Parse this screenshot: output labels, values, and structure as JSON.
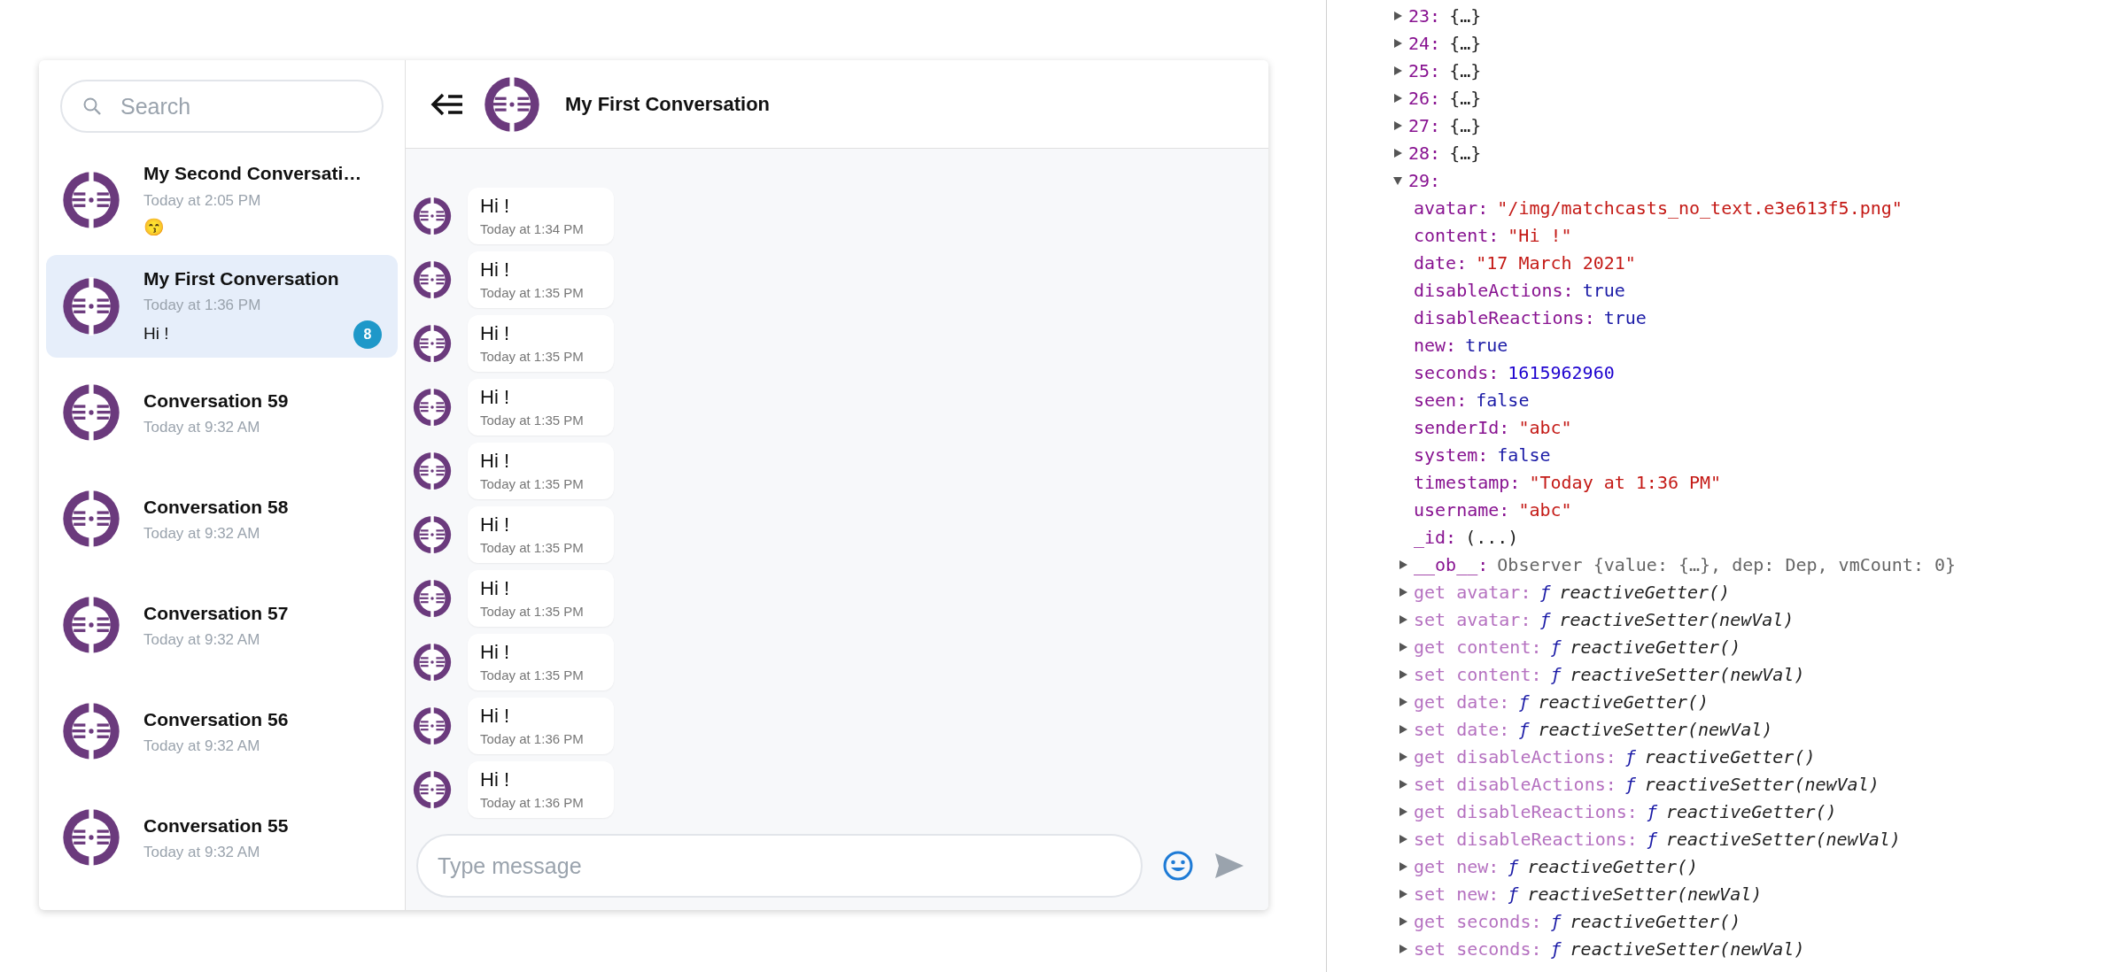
{
  "sidebar": {
    "search": {
      "placeholder": "Search"
    },
    "conversations": [
      {
        "name": "My Second Conversati…",
        "time": "Today at 2:05 PM",
        "preview": "😙",
        "selected": false
      },
      {
        "name": "My First Conversation",
        "time": "Today at 1:36 PM",
        "preview": "Hi !",
        "badge": "8",
        "selected": true
      },
      {
        "name": "Conversation 59",
        "time": "Today at 9:32 AM",
        "selected": false
      },
      {
        "name": "Conversation 58",
        "time": "Today at 9:32 AM",
        "selected": false
      },
      {
        "name": "Conversation 57",
        "time": "Today at 9:32 AM",
        "selected": false
      },
      {
        "name": "Conversation 56",
        "time": "Today at 9:32 AM",
        "selected": false
      },
      {
        "name": "Conversation 55",
        "time": "Today at 9:32 AM",
        "selected": false
      }
    ]
  },
  "chat": {
    "title": "My First Conversation",
    "messages": [
      {
        "text": "Hi !",
        "time": "Today at 1:34 PM"
      },
      {
        "text": "Hi !",
        "time": "Today at 1:35 PM"
      },
      {
        "text": "Hi !",
        "time": "Today at 1:35 PM"
      },
      {
        "text": "Hi !",
        "time": "Today at 1:35 PM"
      },
      {
        "text": "Hi !",
        "time": "Today at 1:35 PM"
      },
      {
        "text": "Hi !",
        "time": "Today at 1:35 PM"
      },
      {
        "text": "Hi !",
        "time": "Today at 1:35 PM"
      },
      {
        "text": "Hi !",
        "time": "Today at 1:35 PM"
      },
      {
        "text": "Hi !",
        "time": "Today at 1:36 PM"
      },
      {
        "text": "Hi !",
        "time": "Today at 1:36 PM"
      }
    ],
    "input": {
      "placeholder": "Type message"
    }
  },
  "devtools": {
    "items": [
      {
        "kind": "node",
        "key": "23:",
        "value": "{…}",
        "expanded": false
      },
      {
        "kind": "node",
        "key": "24:",
        "value": "{…}",
        "expanded": false
      },
      {
        "kind": "node",
        "key": "25:",
        "value": "{…}",
        "expanded": false
      },
      {
        "kind": "node",
        "key": "26:",
        "value": "{…}",
        "expanded": false
      },
      {
        "kind": "node",
        "key": "27:",
        "value": "{…}",
        "expanded": false
      },
      {
        "kind": "node",
        "key": "28:",
        "value": "{…}",
        "expanded": false
      },
      {
        "kind": "node",
        "key": "29:",
        "expanded": true,
        "children": [
          {
            "kind": "prop",
            "key": "avatar:",
            "value": "\"/img/matchcasts_no_text.e3e613f5.png\"",
            "color": "#c41a16"
          },
          {
            "kind": "prop",
            "key": "content:",
            "value": "\"Hi !\"",
            "color": "#c41a16"
          },
          {
            "kind": "prop",
            "key": "date:",
            "value": "\"17 March 2021\"",
            "color": "#c41a16"
          },
          {
            "kind": "prop",
            "key": "disableActions:",
            "value": "true",
            "color": "#1a1aa6"
          },
          {
            "kind": "prop",
            "key": "disableReactions:",
            "value": "true",
            "color": "#1a1aa6"
          },
          {
            "kind": "prop",
            "key": "new:",
            "value": "true",
            "color": "#1a1aa6"
          },
          {
            "kind": "prop",
            "key": "seconds:",
            "value": "1615962960",
            "color": "#1c00cf"
          },
          {
            "kind": "prop",
            "key": "seen:",
            "value": "false",
            "color": "#1a1aa6"
          },
          {
            "kind": "prop",
            "key": "senderId:",
            "value": "\"abc\"",
            "color": "#c41a16"
          },
          {
            "kind": "prop",
            "key": "system:",
            "value": "false",
            "color": "#1a1aa6"
          },
          {
            "kind": "prop",
            "key": "timestamp:",
            "value": "\"Today at 1:36 PM\"",
            "color": "#c41a16"
          },
          {
            "kind": "prop",
            "key": "username:",
            "value": "\"abc\"",
            "color": "#c41a16"
          },
          {
            "kind": "prop",
            "key": "_id:",
            "value": "(...)",
            "color": "#222222"
          },
          {
            "kind": "node",
            "key": "__ob__:",
            "value": "Observer {value: {…}, dep: Dep, vmCount: 0}",
            "expanded": false
          },
          {
            "kind": "accessor",
            "key": "get avatar:",
            "glyph": "ƒ",
            "value": "reactiveGetter()",
            "expanded": false
          },
          {
            "kind": "accessor",
            "key": "set avatar:",
            "glyph": "ƒ",
            "value": "reactiveSetter(newVal)",
            "expanded": false
          },
          {
            "kind": "accessor",
            "key": "get content:",
            "glyph": "ƒ",
            "value": "reactiveGetter()",
            "expanded": false
          },
          {
            "kind": "accessor",
            "key": "set content:",
            "glyph": "ƒ",
            "value": "reactiveSetter(newVal)",
            "expanded": false
          },
          {
            "kind": "accessor",
            "key": "get date:",
            "glyph": "ƒ",
            "value": "reactiveGetter()",
            "expanded": false
          },
          {
            "kind": "accessor",
            "key": "set date:",
            "glyph": "ƒ",
            "value": "reactiveSetter(newVal)",
            "expanded": false
          },
          {
            "kind": "accessor",
            "key": "get disableActions:",
            "glyph": "ƒ",
            "value": "reactiveGetter()",
            "expanded": false
          },
          {
            "kind": "accessor",
            "key": "set disableActions:",
            "glyph": "ƒ",
            "value": "reactiveSetter(newVal)",
            "expanded": false
          },
          {
            "kind": "accessor",
            "key": "get disableReactions:",
            "glyph": "ƒ",
            "value": "reactiveGetter()",
            "expanded": false
          },
          {
            "kind": "accessor",
            "key": "set disableReactions:",
            "glyph": "ƒ",
            "value": "reactiveSetter(newVal)",
            "expanded": false
          },
          {
            "kind": "accessor",
            "key": "get new:",
            "glyph": "ƒ",
            "value": "reactiveGetter()",
            "expanded": false
          },
          {
            "kind": "accessor",
            "key": "set new:",
            "glyph": "ƒ",
            "value": "reactiveSetter(newVal)",
            "expanded": false
          },
          {
            "kind": "accessor",
            "key": "get seconds:",
            "glyph": "ƒ",
            "value": "reactiveGetter()",
            "expanded": false
          },
          {
            "kind": "accessor",
            "key": "set seconds:",
            "glyph": "ƒ",
            "value": "reactiveSetter(newVal)",
            "expanded": false
          }
        ]
      }
    ]
  }
}
